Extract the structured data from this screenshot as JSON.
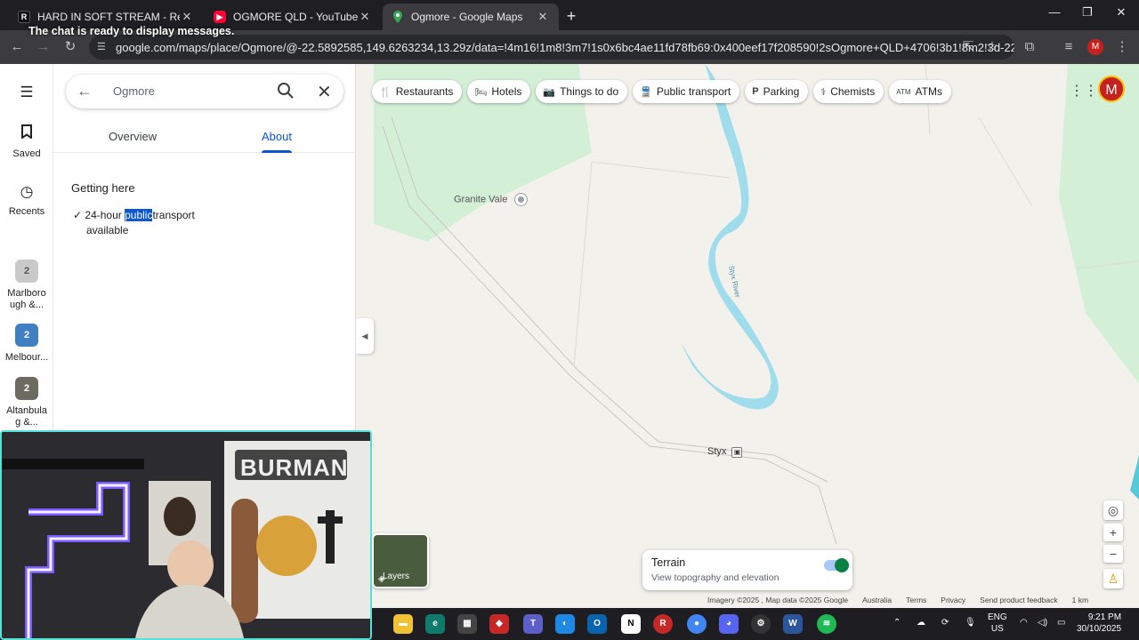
{
  "browser": {
    "tabs": [
      {
        "title": "HARD IN SOFT STREAM - Restr",
        "overlay_title": "Return"
      },
      {
        "title": "OGMORE QLD - YouTube"
      },
      {
        "title": "Ogmore - Google Maps"
      }
    ],
    "overlay_message": "The chat is ready to display messages.",
    "url": "google.com/maps/place/Ogmore/@-22.5892585,149.6263234,13.29z/data=!4m16!1m8!3m7!1s0x6bc4ae11fd78fb69:0x400eef17f208590!2sOgmore+QLD+4706!3b1!8m2!3d-22.6211...",
    "profile_initial": "M"
  },
  "rail": {
    "saved_label": "Saved",
    "recents_label": "Recents",
    "recent_items": [
      {
        "label": "Marlboro ugh &...",
        "badge": "2"
      },
      {
        "label": "Melbour...",
        "badge": "2"
      },
      {
        "label": "Altanbula g &...",
        "badge": "2"
      }
    ]
  },
  "panel": {
    "search_value": "Ogmore",
    "tabs": [
      "Overview",
      "About"
    ],
    "active_tab": "About",
    "section_title": "Getting here",
    "amenity_prefix": "24-hour",
    "amenity_highlight": "public",
    "amenity_suffix": "transport",
    "amenity_line2": "available"
  },
  "map": {
    "chips": [
      {
        "icon": "restaurant-icon",
        "label": "Restaurants"
      },
      {
        "icon": "hotel-icon",
        "label": "Hotels"
      },
      {
        "icon": "camera-icon",
        "label": "Things to do"
      },
      {
        "icon": "transit-icon",
        "label": "Public transport"
      },
      {
        "icon": "parking-icon",
        "label": "Parking"
      },
      {
        "icon": "pharmacy-icon",
        "label": "Chemists"
      },
      {
        "icon": "atm-icon",
        "label": "ATMs"
      }
    ],
    "places": [
      {
        "name": "Granite Vale"
      },
      {
        "name": "Styx"
      },
      {
        "name": "Styx River"
      }
    ],
    "terrain_title": "Terrain",
    "terrain_subtitle": "View topography and elevation",
    "terrain_on": true,
    "layers_label": "Layers",
    "footer": [
      "Imagery ©2025 , Map data ©2025 Google",
      "Australia",
      "Terms",
      "Privacy",
      "Send product feedback",
      "1 km"
    ],
    "profile_initial": "M"
  },
  "webcam": {
    "sign_text": "BURMAN"
  },
  "taskbar": {
    "lang": "ENG",
    "region": "US",
    "time": "9:21 PM",
    "date": "30/10/2025"
  },
  "colors": {
    "river": "#9fdcec",
    "vegetation": "#d3efd6",
    "accent": "#0b57d0"
  }
}
